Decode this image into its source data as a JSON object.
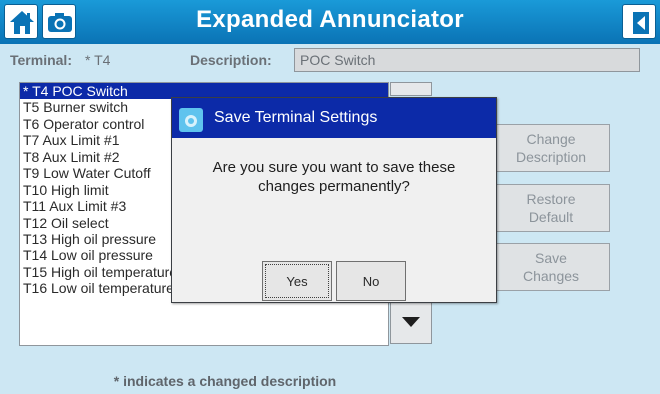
{
  "window": {
    "title": "Expanded Annunciator"
  },
  "toolbar": {
    "home_icon": "home-icon",
    "camera_icon": "camera-icon",
    "exit_icon": "exit-door-icon"
  },
  "terminal": {
    "label": "Terminal:",
    "value": "* T4"
  },
  "description": {
    "label": "Description:",
    "value": "POC Switch"
  },
  "terminal_list": [
    "* T4 POC Switch",
    "T5 Burner switch",
    "T6 Operator control",
    "T7 Aux Limit #1",
    "T8 Aux Limit #2",
    "T9 Low Water Cutoff",
    "T10 High limit",
    "T11 Aux Limit #3",
    "T12 Oil select",
    "T13 High oil pressure",
    "T14 Low oil pressure",
    "T15 High oil temperature",
    "T16 Low oil temperature"
  ],
  "buttons": {
    "change_description": [
      "Change",
      "Description"
    ],
    "restore_default": [
      "Restore",
      "Default"
    ],
    "save_changes": [
      "Save",
      "Changes"
    ]
  },
  "footnote": "* indicates a changed description",
  "dialog": {
    "title": "Save Terminal Settings",
    "message_line1": "Are you sure you want to save these",
    "message_line2": "changes permanently?",
    "yes_label": "Yes",
    "no_label": "No"
  },
  "colors": {
    "titlebar": "#0a73b5",
    "selection": "#0c2aa8",
    "background": "#cde7f3"
  }
}
